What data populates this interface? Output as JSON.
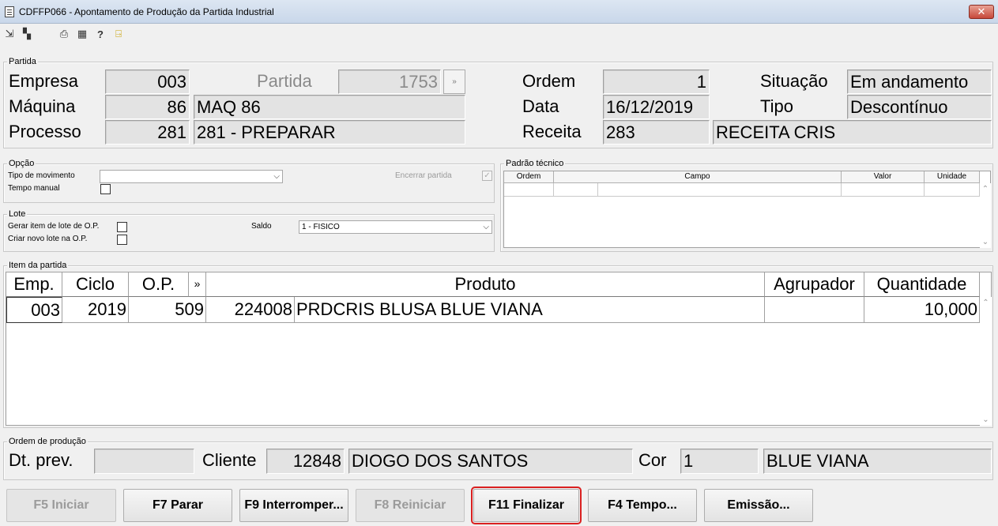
{
  "window": {
    "title": "CDFFP066 - Apontamento de Produção da Partida Industrial",
    "close": "✕"
  },
  "toolbar": {
    "icons": [
      "arrow-icon",
      "copy-icon",
      "print-icon",
      "calendar-icon",
      "help-icon",
      "exit-icon"
    ]
  },
  "partida": {
    "group_title": "Partida",
    "empresa_label": "Empresa",
    "empresa": "003",
    "partida_label": "Partida",
    "partida": "1753",
    "partida_btn": "»",
    "maquina_label": "Máquina",
    "maquina": "86",
    "maquina_desc": "MAQ 86",
    "processo_label": "Processo",
    "processo": "281",
    "processo_desc": "281 - PREPARAR",
    "ordem_label": "Ordem",
    "ordem": "1",
    "data_label": "Data",
    "data": "16/12/2019",
    "receita_label": "Receita",
    "receita": "283",
    "receita_desc": "RECEITA CRIS",
    "situacao_label": "Situação",
    "situacao": "Em andamento",
    "tipo_label": "Tipo",
    "tipo": "Descontínuo"
  },
  "opcao": {
    "group_title": "Opção",
    "tipo_mov_label": "Tipo de movimento",
    "tipo_mov_value": "",
    "tempo_manual_label": "Tempo manual",
    "encerrar_label": "Encerrar partida"
  },
  "lote": {
    "group_title": "Lote",
    "gerar_label": "Gerar item de lote de O.P.",
    "criar_label": "Criar novo lote na O.P.",
    "saldo_label": "Saldo",
    "saldo_value": "1 - FISICO"
  },
  "padrao": {
    "group_title": "Padrão técnico",
    "columns": [
      "Ordem",
      "Campo",
      "Valor",
      "Unidade"
    ]
  },
  "item": {
    "group_title": "Item da partida",
    "columns": [
      "Emp.",
      "Ciclo",
      "O.P.",
      "»",
      "Produto",
      "Agrupador",
      "Quantidade"
    ],
    "rows": [
      {
        "emp": "003",
        "ciclo": "2019",
        "op": "509",
        "code": "224008",
        "produto": "PRDCRIS BLUSA BLUE VIANA",
        "agrupador": "",
        "quantidade": "10,000"
      }
    ]
  },
  "ordem_prod": {
    "group_title": "Ordem de produção",
    "dt_prev_label": "Dt. prev.",
    "dt_prev": "",
    "cliente_label": "Cliente",
    "cliente_code": "12848",
    "cliente_name": "DIOGO DOS SANTOS",
    "cor_label": "Cor",
    "cor_code": "1",
    "cor_name": "BLUE VIANA"
  },
  "buttons": {
    "iniciar": "F5 Iniciar",
    "parar": "F7 Parar",
    "interromper": "F9 Interromper...",
    "reiniciar": "F8 Reiniciar",
    "finalizar": "F11 Finalizar",
    "tempo": "F4 Tempo...",
    "emissao": "Emissão..."
  }
}
